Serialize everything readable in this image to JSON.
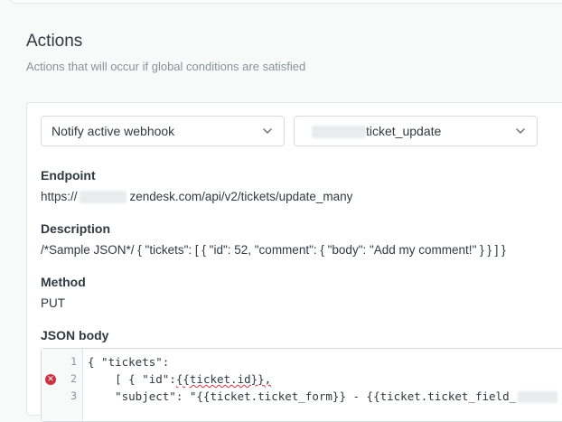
{
  "section": {
    "title": "Actions",
    "subtitle": "Actions that will occur if global conditions are satisfied"
  },
  "action_select": {
    "value": "Notify active webhook"
  },
  "webhook_select": {
    "value_suffix": "ticket_update"
  },
  "endpoint": {
    "label": "Endpoint",
    "prefix": "https://",
    "suffix": "zendesk.com/api/v2/tickets/update_many"
  },
  "description": {
    "label": "Description",
    "value": "/*Sample JSON*/ { \"tickets\": [ { \"id\": 52, \"comment\": { \"body\": \"Add my comment!\" } } ] }"
  },
  "method": {
    "label": "Method",
    "value": "PUT"
  },
  "json_body": {
    "label": "JSON body",
    "lines": [
      {
        "num": "1",
        "code": "{ \"tickets\":"
      },
      {
        "num": "2",
        "code_a": "    [ { \"id\":",
        "code_b": "{{ticket.id}},",
        "error": true
      },
      {
        "num": "3",
        "code": "    \"subject\": \"{{ticket.ticket_form}} - {{ticket.ticket_field_"
      }
    ]
  },
  "icons": {
    "chevron": "chevron-down-icon",
    "error": "error-icon"
  },
  "colors": {
    "error": "#cc3340",
    "muted": "#87929d",
    "text": "#2f3941"
  }
}
